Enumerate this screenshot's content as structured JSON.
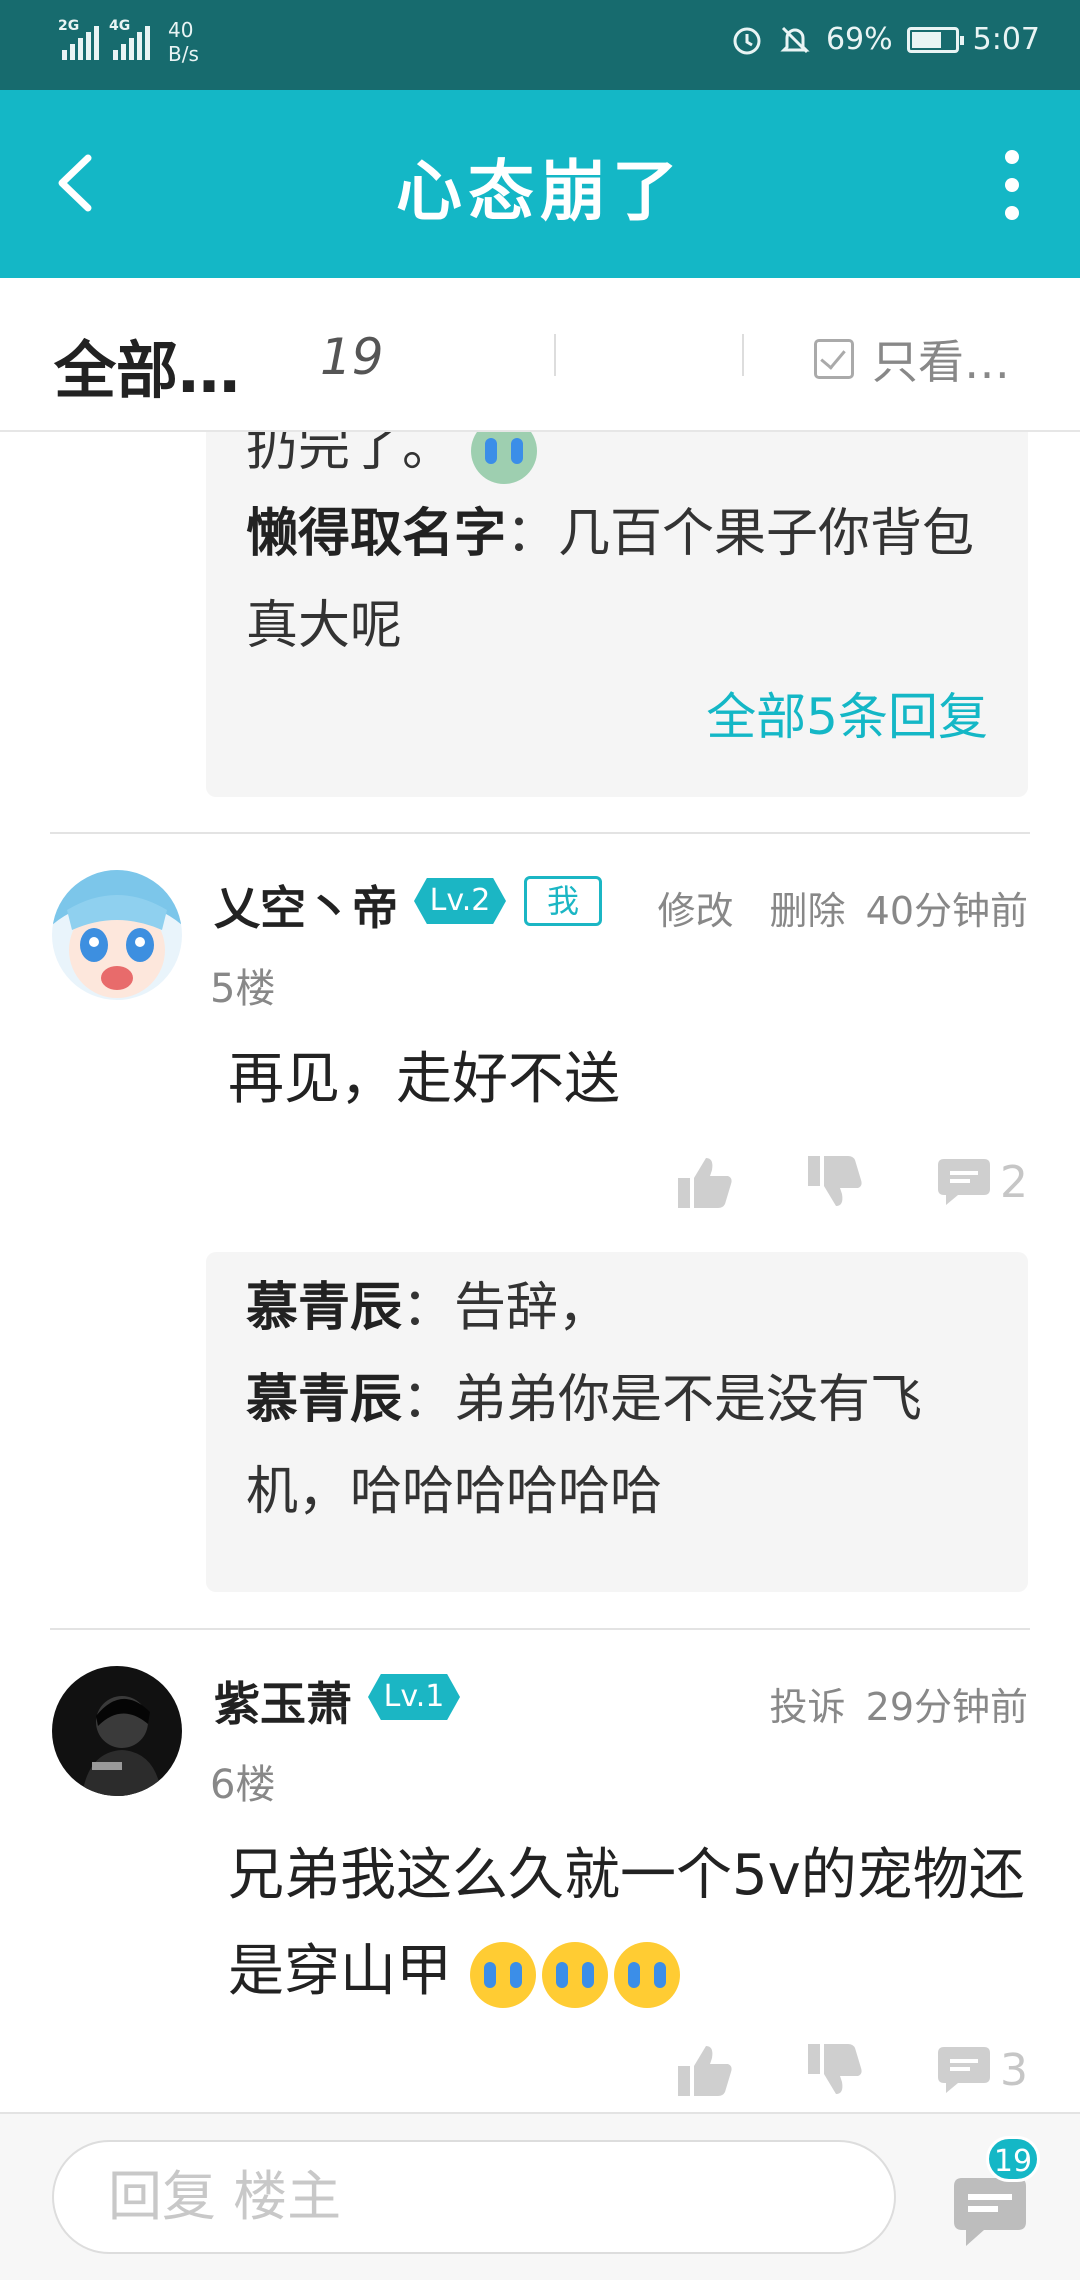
{
  "status_bar": {
    "signal1": "2G",
    "signal2": "4G",
    "speed_value": "40",
    "speed_unit": "B/s",
    "battery": "69%",
    "battery_level": 0.69,
    "time": "5:07"
  },
  "header": {
    "title": "心态崩了"
  },
  "filter": {
    "all_label": "全部…",
    "count": "19",
    "only_label": "只看…"
  },
  "prev_replies": {
    "partial_text": "扔完了。",
    "lines": [
      {
        "name": "懒得取名字",
        "text": "：几百个果子你背包真大呢"
      }
    ],
    "all_link": "全部5条回复"
  },
  "posts": [
    {
      "username": "乂空丶帝",
      "level": "Lv.2",
      "me_badge": "我",
      "actions": [
        "修改",
        "删除"
      ],
      "time": "40分钟前",
      "floor": "5楼",
      "text": "再见，走好不送",
      "comment_count": "2",
      "replies": [
        {
          "name": "慕青辰",
          "text": "：告辞，"
        },
        {
          "name": "慕青辰",
          "text": "：弟弟你是不是没有飞机，哈哈哈哈哈哈"
        }
      ]
    },
    {
      "username": "紫玉萧",
      "level": "Lv.1",
      "actions": [
        "投诉"
      ],
      "time": "29分钟前",
      "floor": "6楼",
      "text": "兄弟我这么久就一个5v的宠物还是穿山甲",
      "comment_count": "3"
    }
  ],
  "bottom": {
    "placeholder": "回复 楼主",
    "badge": "19"
  }
}
